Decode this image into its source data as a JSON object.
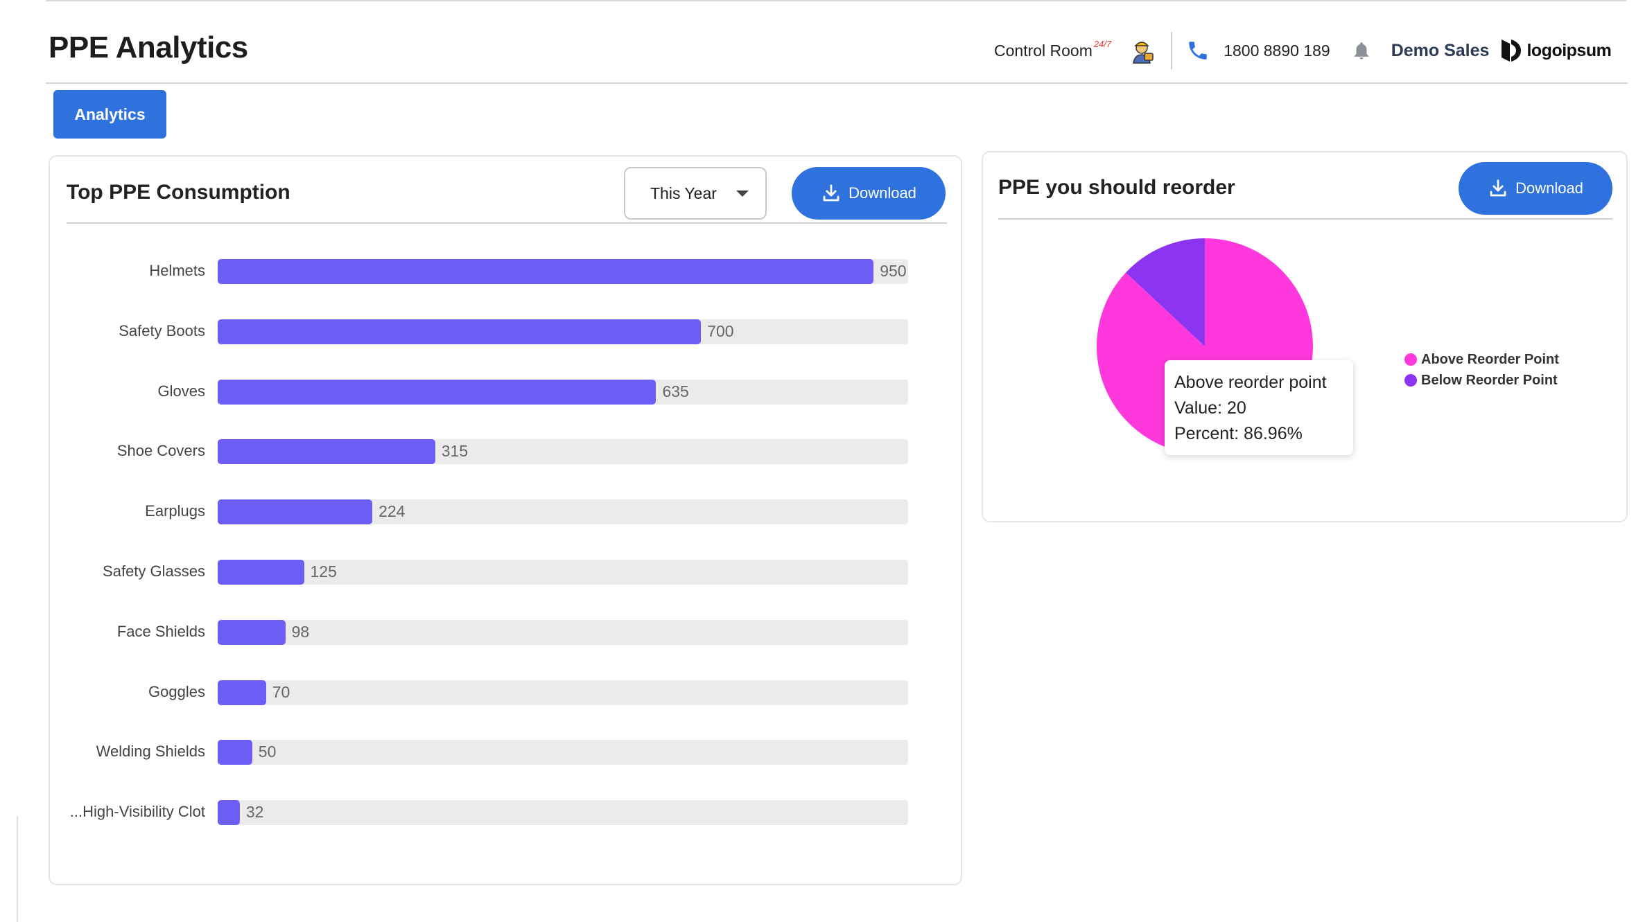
{
  "header": {
    "title": "PPE Analytics",
    "control_room": "Control Room",
    "control_room_sup": "24/7",
    "phone": "1800 8890 189",
    "user": "Demo Sales",
    "logo_text": "logoipsum"
  },
  "tabs": [
    {
      "label": "Analytics",
      "active": true
    }
  ],
  "consumption": {
    "title": "Top PPE Consumption",
    "period": "This Year",
    "download_label": "Download",
    "chart_data": {
      "type": "bar",
      "orientation": "horizontal",
      "categories": [
        "Helmets",
        "Safety Boots",
        "Gloves",
        "Shoe Covers",
        "Earplugs",
        "Safety Glasses",
        "Face Shields",
        "Goggles",
        "Welding Shields",
        "High-Visibility Clot..."
      ],
      "values": [
        950,
        700,
        635,
        315,
        224,
        125,
        98,
        70,
        50,
        32
      ],
      "xlim": [
        0,
        1000
      ],
      "bar_color": "#6c5ef5",
      "track_color": "#ebebeb"
    }
  },
  "reorder": {
    "title": "PPE you should reorder",
    "download_label": "Download",
    "chart_data": {
      "type": "pie",
      "series": [
        {
          "name": "Above Reorder Point",
          "value": 20,
          "percent": 86.96,
          "color": "#ff38de"
        },
        {
          "name": "Below Reorder Point",
          "value": 3,
          "percent": 13.04,
          "color": "#8b35f0"
        }
      ],
      "legend": "right"
    },
    "tooltip": {
      "title": "Above reorder point",
      "value_line": "Value: 20",
      "percent_line": "Percent: 86.96%"
    }
  },
  "colors": {
    "primary": "#2f72dd",
    "bar": "#6c5ef5",
    "pie_above": "#ff38de",
    "pie_below": "#8b35f0"
  }
}
